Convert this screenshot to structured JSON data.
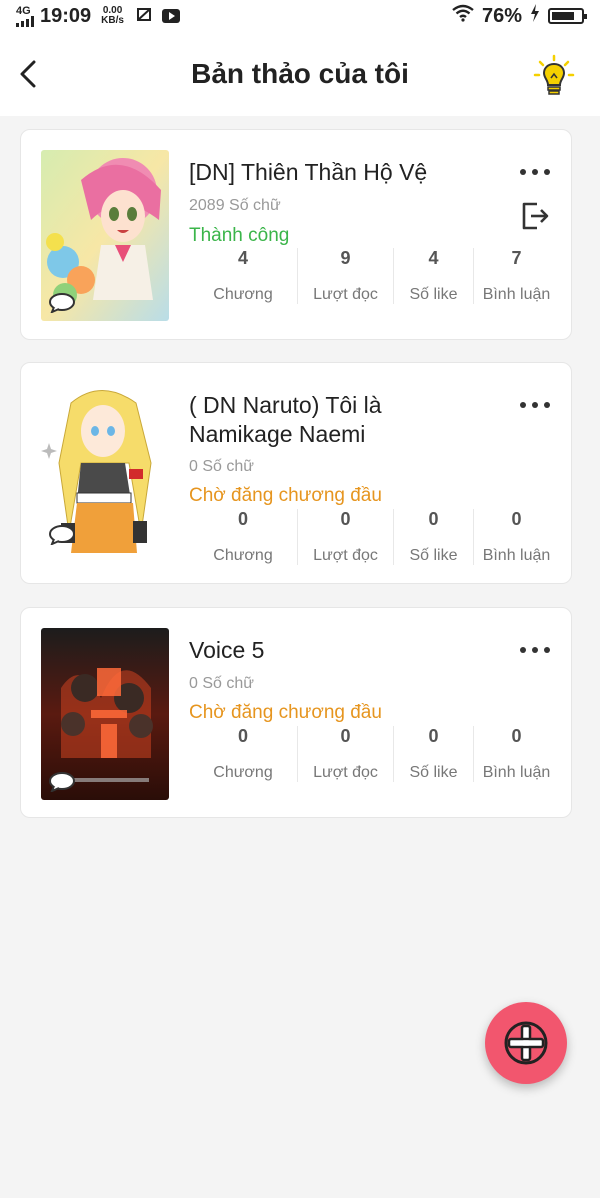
{
  "status_bar": {
    "network": "4G",
    "time": "19:09",
    "speed_value": "0.00",
    "speed_unit": "KB/s",
    "battery": "76%"
  },
  "header": {
    "title": "Bản thảo của tôi"
  },
  "stat_labels": [
    "Chương",
    "Lượt đọc",
    "Số like",
    "Bình luận"
  ],
  "books": [
    {
      "title": "[DN] Thiên Thần Hộ Vệ",
      "word_count": "2089 Số chữ",
      "status": "Thành công",
      "stats": [
        "4",
        "9",
        "4",
        "7"
      ]
    },
    {
      "title": "( DN Naruto) Tôi là Namikage Naemi",
      "word_count": "0 Số chữ",
      "status": "Chờ đăng chương đầu",
      "stats": [
        "0",
        "0",
        "0",
        "0"
      ]
    },
    {
      "title": "Voice 5",
      "word_count": "0 Số chữ",
      "status": "Chờ đăng chương đầu",
      "stats": [
        "0",
        "0",
        "0",
        "0"
      ]
    }
  ],
  "colors": {
    "success": "#3bb54a",
    "pending": "#e6951f",
    "fab": "#f2566e",
    "bulb": "#f5d000"
  }
}
